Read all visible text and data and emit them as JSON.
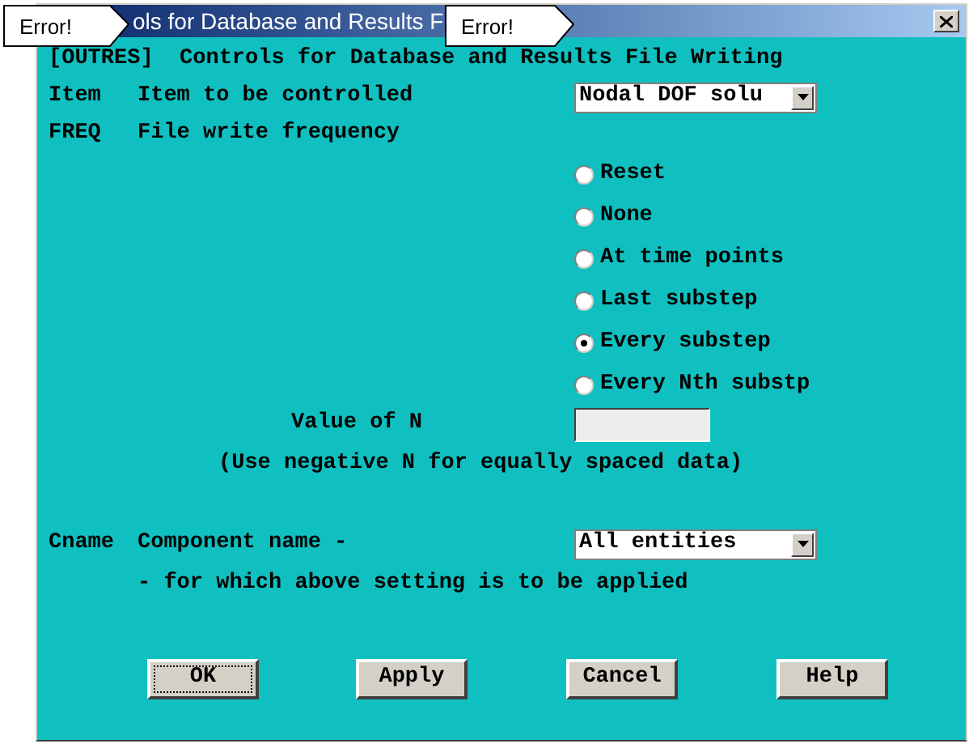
{
  "window": {
    "title": "ols for Database and Results F"
  },
  "callouts": [
    {
      "text": "Error!"
    },
    {
      "text": "Error!"
    }
  ],
  "heading": "[OUTRES]  Controls for Database and Results File Writing",
  "item": {
    "key": "Item",
    "label": "Item to be controlled",
    "value": "Nodal DOF solu"
  },
  "freq": {
    "key": "FREQ",
    "label": "File write frequency",
    "options": [
      {
        "label": "Reset",
        "selected": false
      },
      {
        "label": "None",
        "selected": false
      },
      {
        "label": "At time points",
        "selected": false
      },
      {
        "label": "Last substep",
        "selected": false
      },
      {
        "label": "Every substep",
        "selected": true
      },
      {
        "label": "Every Nth substp",
        "selected": false
      }
    ]
  },
  "value_of_n": {
    "label": "Value of N",
    "note": "(Use negative N for equally spaced data)"
  },
  "cname": {
    "key": "Cname",
    "label": "Component name -",
    "value": "All entities",
    "note": "- for which above setting is to be applied"
  },
  "buttons": [
    {
      "label": "OK",
      "default": true
    },
    {
      "label": "Apply",
      "default": false
    },
    {
      "label": "Cancel",
      "default": false
    },
    {
      "label": "Help",
      "default": false
    }
  ]
}
